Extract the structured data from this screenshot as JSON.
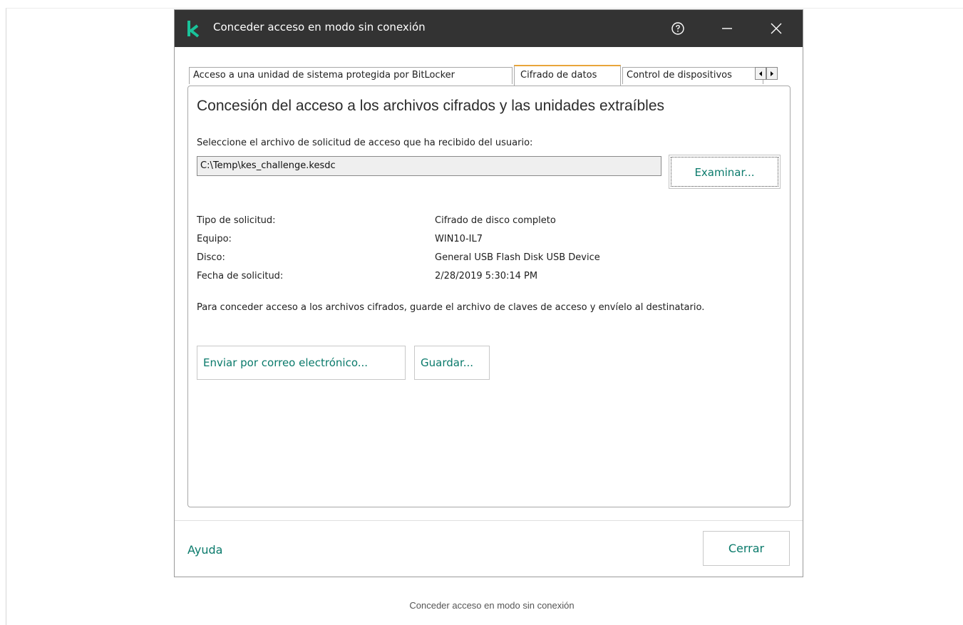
{
  "window": {
    "title": "Conceder acceso en modo sin conexión"
  },
  "tabs": [
    {
      "label": "Acceso a una unidad de sistema protegida por BitLocker",
      "active": false
    },
    {
      "label": "Cifrado de datos",
      "active": true
    },
    {
      "label": "Control de dispositivos",
      "active": false
    }
  ],
  "panel": {
    "title": "Concesión del acceso a los archivos cifrados y las unidades extraíbles",
    "select_label": "Seleccione el archivo de solicitud de acceso que ha recibido del usuario:",
    "file_path": "C:\\Temp\\kes_challenge.kesdc",
    "browse_label": "Examinar...",
    "info": [
      {
        "key": "Tipo de solicitud:",
        "value": "Cifrado de disco completo"
      },
      {
        "key": "Equipo:",
        "value": "WIN10-IL7"
      },
      {
        "key": "Disco:",
        "value": "General USB Flash Disk USB Device"
      },
      {
        "key": "Fecha de solicitud:",
        "value": "2/28/2019 5:30:14 PM"
      }
    ],
    "note": "Para conceder acceso a los archivos cifrados, guarde el archivo de claves de acceso y envíelo al destinatario.",
    "email_label": "Enviar por correo electrónico...",
    "save_label": "Guardar..."
  },
  "footer": {
    "help_label": "Ayuda",
    "close_label": "Cerrar"
  },
  "caption": "Conceder acceso en modo sin conexión",
  "colors": {
    "titlebar": "#333333",
    "accent": "#0a7a6b",
    "active_tab_border": "#e8a53a",
    "logo": "#19c39a"
  },
  "icons": [
    "kaspersky-logo-icon",
    "help-icon",
    "minimize-icon",
    "close-icon",
    "chevron-left-icon",
    "chevron-right-icon"
  ]
}
